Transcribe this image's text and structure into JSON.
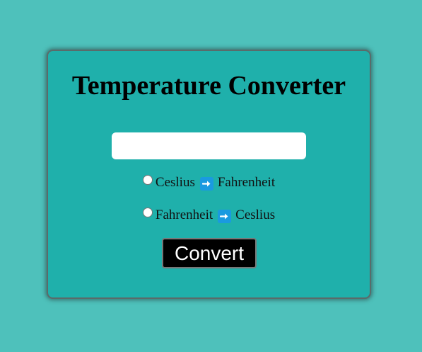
{
  "title": "Temperature Converter",
  "input": {
    "value": "",
    "placeholder": ""
  },
  "options": [
    {
      "from": "Ceslius",
      "to": "Fahrenheit",
      "arrow_icon": "right-arrow-icon",
      "selected": false
    },
    {
      "from": "Fahrenheit",
      "to": "Ceslius",
      "arrow_icon": "right-arrow-icon",
      "selected": false
    }
  ],
  "button": {
    "label": "Convert"
  },
  "colors": {
    "page_background": "#4ec1bb",
    "card_background": "#1fb0ab",
    "arrow_badge": "#1a9ae0",
    "button_background": "#000000",
    "button_text": "#ffffff"
  }
}
